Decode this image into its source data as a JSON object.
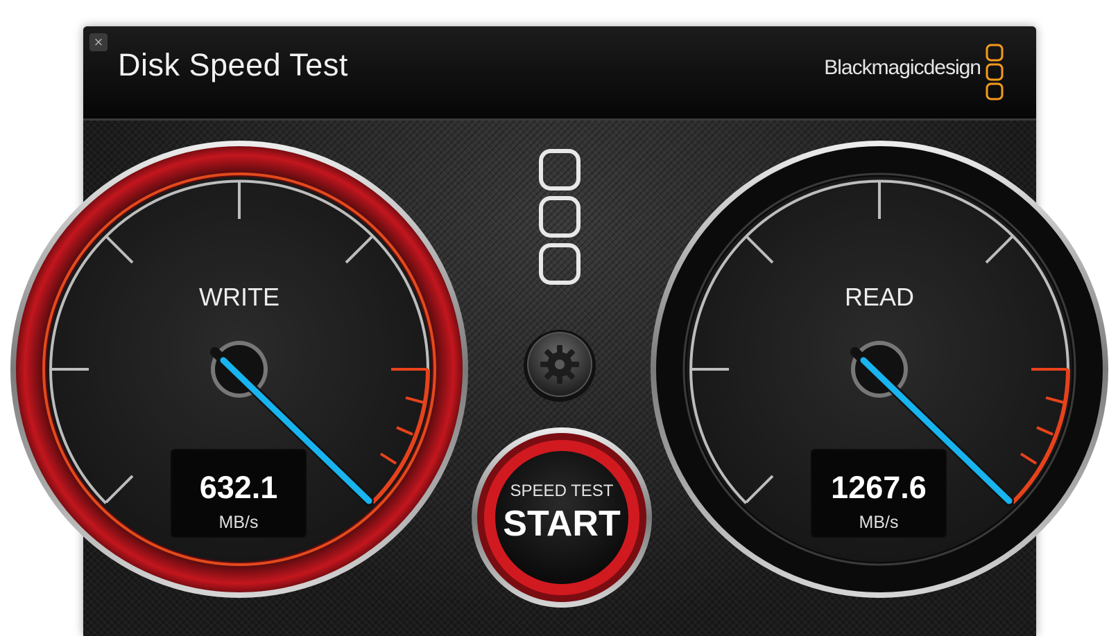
{
  "window": {
    "title": "Disk Speed Test",
    "close_label": "×"
  },
  "brand": {
    "name": "Blackmagicdesign",
    "accent": "#f39a1e"
  },
  "gauges": {
    "write": {
      "label": "WRITE",
      "value": "632.1",
      "unit": "MB/s"
    },
    "read": {
      "label": "READ",
      "value": "1267.6",
      "unit": "MB/s"
    }
  },
  "start_button": {
    "line1": "SPEED TEST",
    "line2": "START"
  },
  "icons": {
    "settings": "gear-icon",
    "logo": "blackmagic-logo-icon"
  },
  "colors": {
    "needle": "#18b4f0",
    "redline": "#e8421c",
    "write_ring": "#b3141b"
  }
}
